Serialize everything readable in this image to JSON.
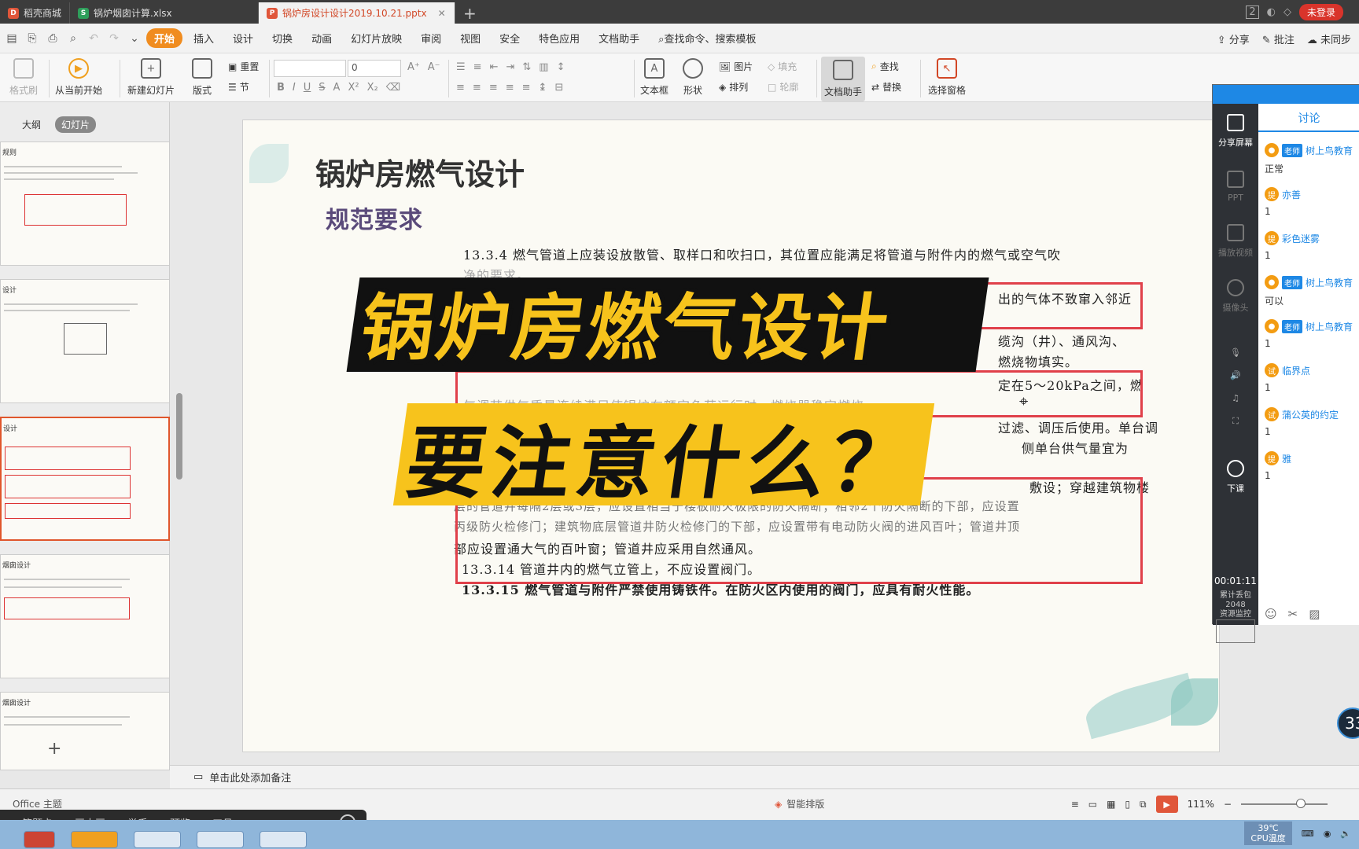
{
  "tabs": [
    {
      "label": "稻壳商城",
      "icon_color": "#e0563a"
    },
    {
      "label": "锅炉烟囱计算.xlsx",
      "icon_color": "#2e9e5b"
    },
    {
      "label": "锅炉房设计设计2019.10.21.pptx",
      "icon_color": "#e0563a"
    }
  ],
  "titlebar": {
    "tab_count": "2",
    "login_label": "未登录"
  },
  "menu": {
    "items": [
      "开始",
      "插入",
      "设计",
      "切换",
      "动画",
      "幻灯片放映",
      "审阅",
      "视图",
      "安全",
      "特色应用",
      "文档助手"
    ],
    "search_label": "查找命令、搜索模板",
    "share_label": "分享",
    "annotate_label": "批注",
    "sync_label": "未同步"
  },
  "ribbon": {
    "format_painter": "格式刷",
    "play_from_current": "从当前开始",
    "new_slide": "新建幻灯片",
    "layout": "版式",
    "reset": "重置",
    "section": "节",
    "font_size": "0",
    "textbox": "文本框",
    "shapes": "形状",
    "picture": "图片",
    "fill": "填充",
    "arrange": "排列",
    "outline": "轮廓",
    "doc_assistant": "文档助手",
    "find": "查找",
    "replace": "替换",
    "selection_pane": "选择窗格"
  },
  "leftpanel": {
    "tab_outline": "大纲",
    "tab_slides": "幻灯片",
    "thumbnails": [
      {
        "title": "规则"
      },
      {
        "title": "设计"
      },
      {
        "title": "设计"
      },
      {
        "title": "烟囱设计"
      },
      {
        "title": "烟囱设计"
      }
    ]
  },
  "slide": {
    "title": "锅炉房燃气设计",
    "subtitle": "规范要求",
    "lines": [
      "13.3.4  燃气管道上应装设放散管、取样口和吹扫口，其位置应能满足将管道与附件内的燃气或空气吹",
      "净的要求。",
      "出的气体不致窜入邻近",
      "缆沟（井）、通风沟、",
      "燃烧物填实。",
      "定在5～20kPa之间，燃",
      "气调节供气质量连续满足使锅炉在额定负荷运行时，燃烧器稳定燃烧。",
      "过滤、调压后使用。单台调",
      "侧单台供气量宜为",
      "敷设；穿越建筑物楼",
      "层的管道井每隔2层或3层，应设置相当于楼板耐火极限的防火隔断；相邻2个防火隔断的下部，应设置",
      "丙级防火检修门；建筑物底层管道井防火检修门的下部，应设置带有电动防火阀的进风百叶；管道井顶",
      "部应设置通大气的百叶窗；管道井应采用自然通风。",
      "13.3.14  管道井内的燃气立管上，不应设置阀门。",
      "13.3.15  燃气管道与附件严禁使用铸铁件。在防火区内使用的阀门，应具有耐火性能。"
    ],
    "overlay_line1": "锅炉房燃气设计",
    "overlay_line2": "要注意什么？"
  },
  "notes": {
    "placeholder": "单击此处添加备注"
  },
  "status": {
    "theme": "Office 主题",
    "smart_layout": "智能排版",
    "zoom": "111%"
  },
  "bottombar": {
    "items": [
      "答题卡",
      "画中画",
      "举手",
      "预览",
      "工具"
    ]
  },
  "taskbar": {
    "temp": "39℃",
    "cpu_label": "CPU温度"
  },
  "sidepanel": {
    "share_screen": "分享屏幕",
    "ppt": "PPT",
    "play_video": "播放视频",
    "camera": "摄像头",
    "end_class": "下课",
    "time": "00:01:11",
    "tiles_label": "累计丢包",
    "tiles_value": "2048",
    "monitor": "资源监控",
    "chat_tab": "讨论",
    "messages": [
      {
        "badge": "老师",
        "name": "树上鸟教育",
        "text": "正常"
      },
      {
        "badge": "",
        "name": "亦善",
        "text": "1"
      },
      {
        "badge": "",
        "name": "彩色迷雾",
        "text": "1"
      },
      {
        "badge": "老师",
        "name": "树上鸟教育",
        "text": "可以"
      },
      {
        "badge": "老师",
        "name": "树上鸟教育",
        "text": "1"
      },
      {
        "badge": "",
        "name": "临界点",
        "text": "1"
      },
      {
        "badge": "",
        "name": "蒲公英的约定",
        "text": "1"
      },
      {
        "badge": "",
        "name": "雅",
        "text": "1"
      }
    ]
  },
  "badge": "33"
}
